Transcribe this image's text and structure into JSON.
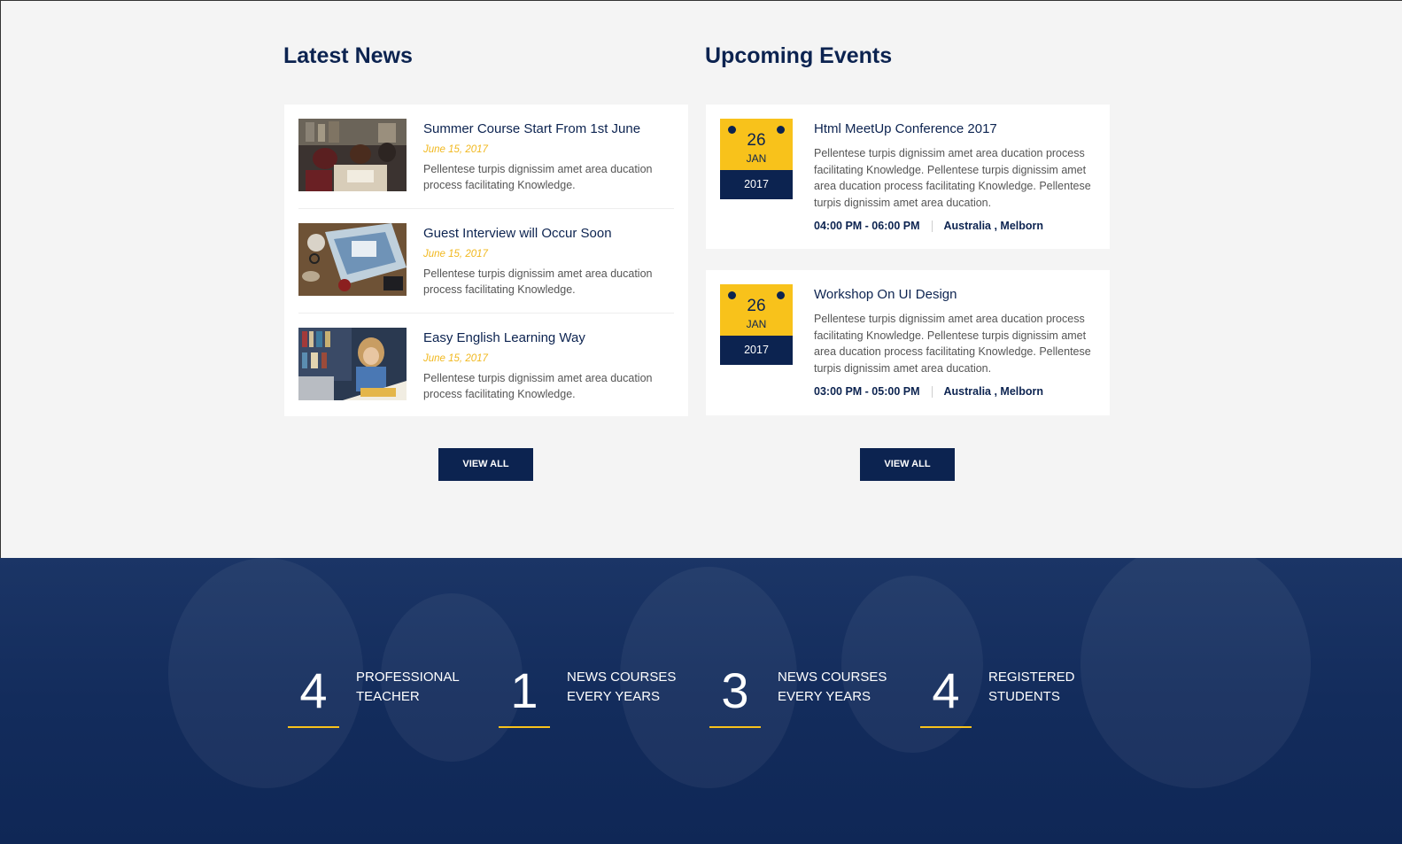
{
  "news": {
    "title": "Latest News",
    "items": [
      {
        "title": "Summer Course Start From 1st June",
        "date": "June 15, 2017",
        "desc": "Pellentese turpis dignissim amet area ducation process facilitating Knowledge."
      },
      {
        "title": "Guest Interview will Occur Soon",
        "date": "June 15, 2017",
        "desc": "Pellentese turpis dignissim amet area ducation process facilitating Knowledge."
      },
      {
        "title": "Easy English Learning Way",
        "date": "June 15, 2017",
        "desc": "Pellentese turpis dignissim amet area ducation process facilitating Knowledge."
      }
    ],
    "view_all": "VIEW ALL"
  },
  "events": {
    "title": "Upcoming Events",
    "items": [
      {
        "day": "26",
        "month": "JAN",
        "year": "2017",
        "title": "Html MeetUp Conference 2017",
        "desc": "Pellentese turpis dignissim amet area ducation process facilitating Knowledge. Pellentese turpis dignissim amet area ducation process facilitating Knowledge. Pellentese turpis dignissim amet area ducation.",
        "time": "04:00 PM - 06:00 PM",
        "location": "Australia , Melborn"
      },
      {
        "day": "26",
        "month": "JAN",
        "year": "2017",
        "title": "Workshop On UI Design",
        "desc": "Pellentese turpis dignissim amet area ducation process facilitating Knowledge. Pellentese turpis dignissim amet area ducation process facilitating Knowledge. Pellentese turpis dignissim amet area ducation.",
        "time": "03:00 PM - 05:00 PM",
        "location": "Australia , Melborn"
      }
    ],
    "view_all": "VIEW ALL"
  },
  "stats": [
    {
      "number": "4",
      "line1": "PROFESSIONAL",
      "line2": "TEACHER"
    },
    {
      "number": "1",
      "line1": "NEWS COURSES",
      "line2": "EVERY YEARS"
    },
    {
      "number": "3",
      "line1": "NEWS COURSES",
      "line2": "EVERY YEARS"
    },
    {
      "number": "4",
      "line1": "REGISTERED",
      "line2": "STUDENTS"
    }
  ],
  "colors": {
    "navy": "#0c2350",
    "accent": "#f8c21b",
    "date": "#f1b81f"
  }
}
